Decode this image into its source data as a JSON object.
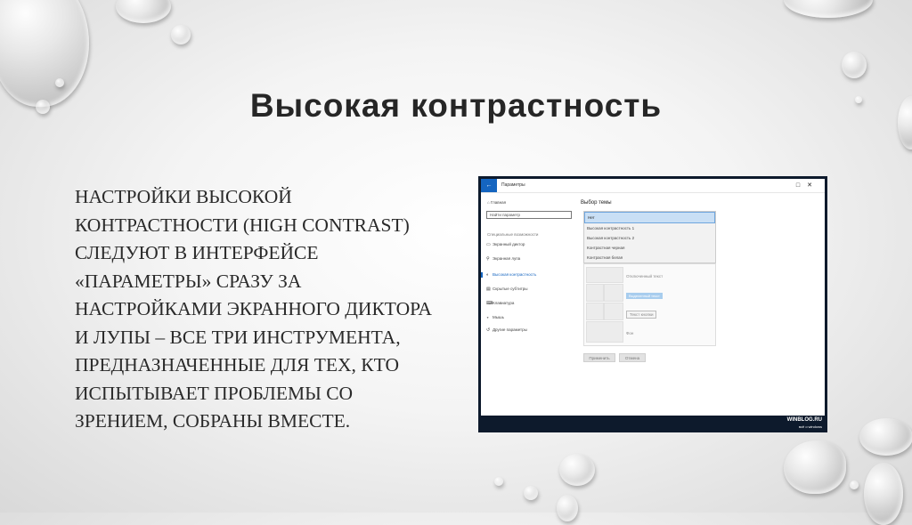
{
  "slide": {
    "title": "Высокая контрастность",
    "body": "Настройки высокой контрастности (High Contrast) следуют в интерфейсе «Параметры» сразу за настройками экранного диктора и лупы – все три инструмента, предназначенные для тех, кто испытывает проблемы со зрением, собраны вместе."
  },
  "screenshot": {
    "window_title": "Параметры",
    "back_icon": "back-arrow-icon",
    "home_label": "Главная",
    "search_placeholder": "Найти параметр",
    "group_label": "Специальные возможности",
    "nav_items": [
      {
        "label": "Экранный диктор",
        "icon": "narrator-icon"
      },
      {
        "label": "Экранная лупа",
        "icon": "magnifier-icon"
      },
      {
        "label": "Высокая контрастность",
        "icon": "contrast-icon"
      },
      {
        "label": "Скрытые субтитры",
        "icon": "captions-icon"
      },
      {
        "label": "Клавиатура",
        "icon": "keyboard-icon"
      },
      {
        "label": "Мышь",
        "icon": "mouse-icon"
      },
      {
        "label": "Другие параметры",
        "icon": "other-icon"
      }
    ],
    "main_heading": "Выбор темы",
    "theme_options": [
      "Нет",
      "Высокая контрастность 1",
      "Высокая контрастность 2",
      "Контрастная черная",
      "Контрастная белая"
    ],
    "preview_texts": {
      "disabled": "Отключенный текст",
      "highlight": "Выделенный текст",
      "button": "Текст кнопки",
      "background": "Фон"
    },
    "apply_label": "Применить",
    "cancel_label": "Отмена",
    "watermark_main": "WINBLOG.RU",
    "watermark_sub": "всё о windows"
  },
  "colors": {
    "accent": "#1565c0",
    "selected_option": "#c9dff5",
    "frame": "#0d1a2c"
  }
}
